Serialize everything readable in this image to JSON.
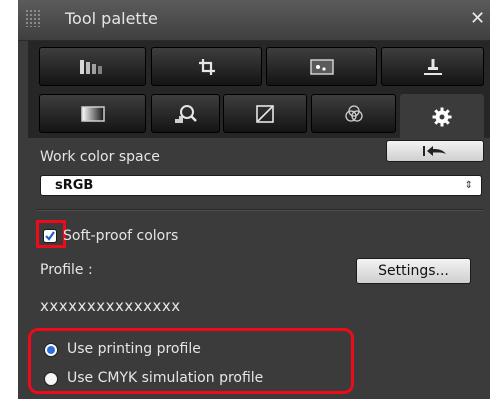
{
  "window": {
    "title": "Tool palette",
    "close_glyph": "✕"
  },
  "tabs_top": [
    {
      "icon": "tone-curve-icon"
    },
    {
      "icon": "crop-icon"
    },
    {
      "icon": "dust-delete-icon"
    },
    {
      "icon": "stamp-icon"
    }
  ],
  "tabs_bottom": [
    {
      "icon": "basic-adjust-icon"
    },
    {
      "icon": "nr-lens-icon"
    },
    {
      "icon": "tone-adjust-icon"
    },
    {
      "icon": "color-adjust-icon"
    },
    {
      "icon": "settings-gear-icon",
      "active": true
    }
  ],
  "work_color_space": {
    "label": "Work color space",
    "value": "sRGB",
    "revert_icon": "revert-icon"
  },
  "soft_proof": {
    "checkbox_label": "Soft-proof colors",
    "checked": true,
    "profile_label": "Profile :",
    "settings_button": "Settings...",
    "profile_value": "xxxxxxxxxxxxxxx"
  },
  "options": [
    {
      "label": "Use printing profile",
      "selected": true
    },
    {
      "label": "Use CMYK simulation profile",
      "selected": false
    }
  ],
  "colors": {
    "accent": "#2d6fd8",
    "highlight": "#ee0a18",
    "panel": "#3b3b3b"
  }
}
